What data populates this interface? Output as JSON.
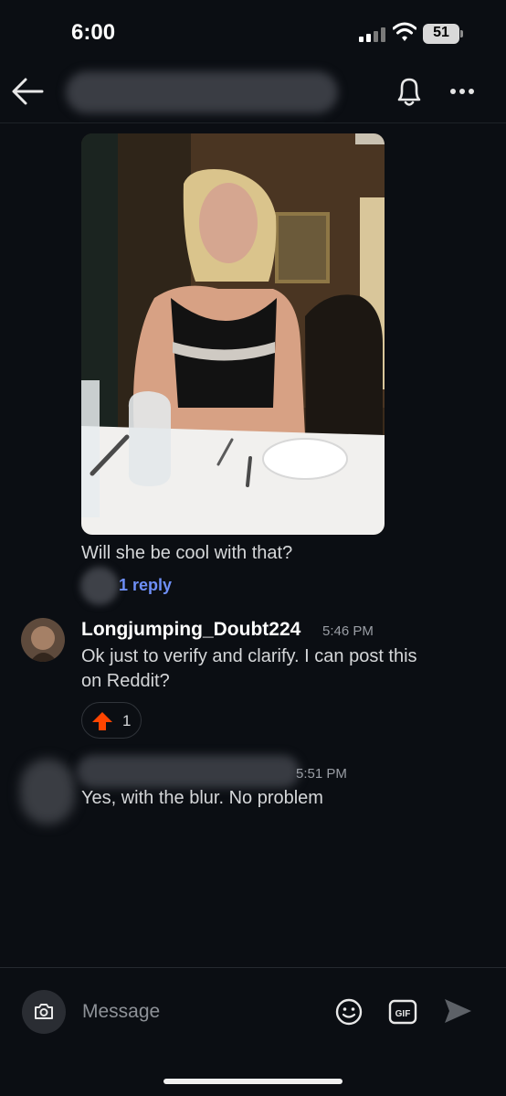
{
  "status_bar": {
    "time": "6:00",
    "battery": "51"
  },
  "thread": {
    "messages": [
      {
        "text": "Will she be cool with that?",
        "replies_label": "1 reply"
      },
      {
        "author": "Longjumping_Doubt224",
        "time": "5:46 PM",
        "text_line1": "Ok just to verify and clarify. I can post this",
        "text_line2": "on Reddit?",
        "upvotes": "1"
      },
      {
        "time": "5:51 PM",
        "text": "Yes, with the blur. No problem"
      }
    ]
  },
  "composer": {
    "placeholder": "Message"
  },
  "icons": {
    "back": "back-arrow-icon",
    "bell": "bell-icon",
    "more": "more-dots-icon",
    "camera": "camera-icon",
    "emoji": "emoji-icon",
    "gif": "gif-icon",
    "send": "send-icon",
    "upvote": "upvote-arrow-icon"
  },
  "colors": {
    "background": "#0b0e13",
    "link": "#6e8ff7",
    "upvote": "#ff4500"
  }
}
